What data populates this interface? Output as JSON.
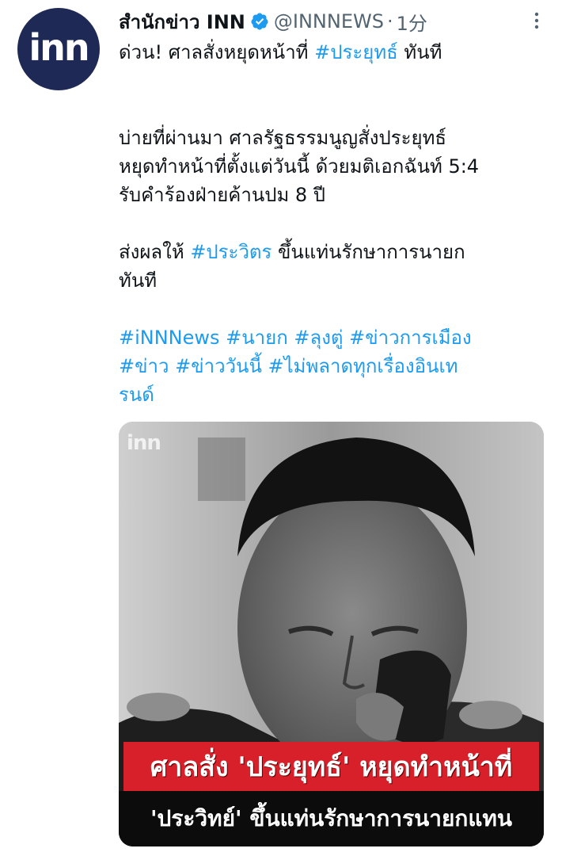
{
  "account": {
    "avatar_text": "inn",
    "name": "สำนักข่าว INN",
    "handle": "@INNNEWS",
    "separator": "·",
    "time": "1分"
  },
  "tweet": {
    "line1_text": "ด่วน! ศาลสั่งหยุดหน้าที่ ",
    "line1_tag": "#ประยุทธ์",
    "line1_after": " ทันที",
    "para2": [
      "บ่ายที่ผ่านมา ศาลรัฐธรรมนูญสั่งประยุทธ์",
      "หยุดทำหน้าที่ตั้งแต่วันนี้ ด้วยมติเอกฉันท์ 5:4",
      "รับคำร้องฝ่ายค้านปม 8 ปี"
    ],
    "para3_text": "ส่งผลให้ ",
    "para3_tag": "#ประวิตร",
    "para3_after": " ขึ้นแท่นรักษาการนายก",
    "para3_line2": "ทันที",
    "hashtags_line1": "#iNNNews #นายก #ลุงตู่ #ข่าวการเมือง",
    "hashtags_line2": "#ข่าว #ข่าววันนี้ #ไม่พลาดทุกเรื่องอินเท",
    "hashtags_line3": "รนด์"
  },
  "media": {
    "watermark": "inn",
    "caption_line1": "ศาลสั่ง 'ประยุทธ์' หยุดทำหน้าที่",
    "caption_line2": "'ประวิทย์' ขึ้นแท่นรักษาการนายกแทน"
  },
  "colors": {
    "link": "#1d9bf0",
    "avatar_bg": "#1e2a55",
    "caption_red": "#d7202a",
    "caption_black": "#0c0c0c"
  },
  "icons": [
    "verified-badge-icon",
    "more-icon"
  ]
}
